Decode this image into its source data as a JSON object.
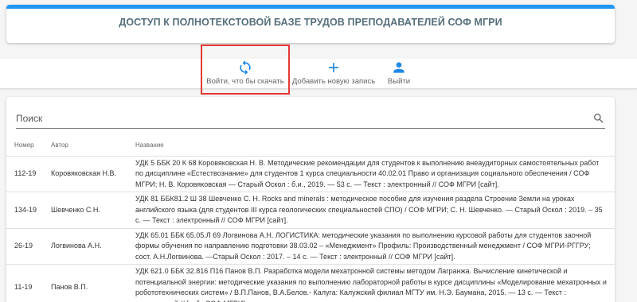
{
  "header": {
    "title": "ДОСТУП К ПОЛНОТЕКСТОВОЙ БАЗЕ ТРУДОВ ПРЕПОДАВАТЕЛЕЙ СОФ МГРИ",
    "accent_color": "#2196f3"
  },
  "toolbar": {
    "login_label": "Войти, что бы скачать",
    "login_icon": "sync-icon",
    "add_label": "Добавить новую запись",
    "add_icon": "plus-icon",
    "logout_label": "Выйти",
    "logout_icon": "person-icon",
    "highlight_color": "#e53935"
  },
  "search": {
    "placeholder": "Поиск",
    "icon": "search-icon"
  },
  "table": {
    "headers": {
      "number": "Номер",
      "author": "Автор",
      "title": "Название"
    },
    "rows": [
      {
        "number": "112-19",
        "author": "Коровяковская Н.В.",
        "title": "УДК 5 ББК 20 К 68 Коровяковская Н. В. Методические рекомендации для студентов к выполнению внеаудиторных самостоятельных работ по дисциплине «Естествознание» для студентов 1 курса специальности 40.02.01 Право и организация социального обеспечения / СОФ МГРИ; Н. В. Коровяковская — Старый Оскол : б.и., 2019. — 53 с. — Текст : электронный // СОФ МГРИ [сайт]."
      },
      {
        "number": "134-19",
        "author": "Шевченко С.Н.",
        "title": "УДК 81 ББК81.2 Ш 38 Шевченко С. Н. Rocks and minerals : методическое пособие для изучения раздела Строение Земли на уроках английского языка (для студентов III курса геологических специальностей СПО) / СОФ МГРИ; С. Н. Шевченко. — Старый Оскол : 2019. – 35 с. — Текст : электронный // СОФ МГРИ [сайт]."
      },
      {
        "number": "26-19",
        "author": "Логвинова А.Н.",
        "title": "УДК 65.01 ББК 65.05.Л 69 Логвинова А.Н. ЛОГИСТИКА: методические указания по выполнению курсовой работы для студентов заочной формы обучения по направлению подготовки 38.03.02 – «Менеджмент» Профиль: Производственный менеджмент / СОФ МГРИ-РГГРУ; сост. А.Н.Логвинова. —Старый Оскол : 2017. – 14 с. — Текст : электронный // СОФ МГРИ [сайт]."
      },
      {
        "number": "11-19",
        "author": "Панов В.П.",
        "title": "УДК 621.0 ББК 32.816 П16 Панов В.П. Разработка модели мехатронной системы методом Лагранжа. Вычисление кинетической и потенциальной энергии: методические указания по выполнению лабораторной работы в курсе дисциплины «Моделирование мехатронных и робототехнических систем» / В.П.Панов, В.А.Белов.- Калуга: Калужский филиал МГТУ им. Н.Э. Баумана, 2015. — 13 с. — Текст : электронный // [сайт СОФ МГРИ]."
      }
    ]
  }
}
